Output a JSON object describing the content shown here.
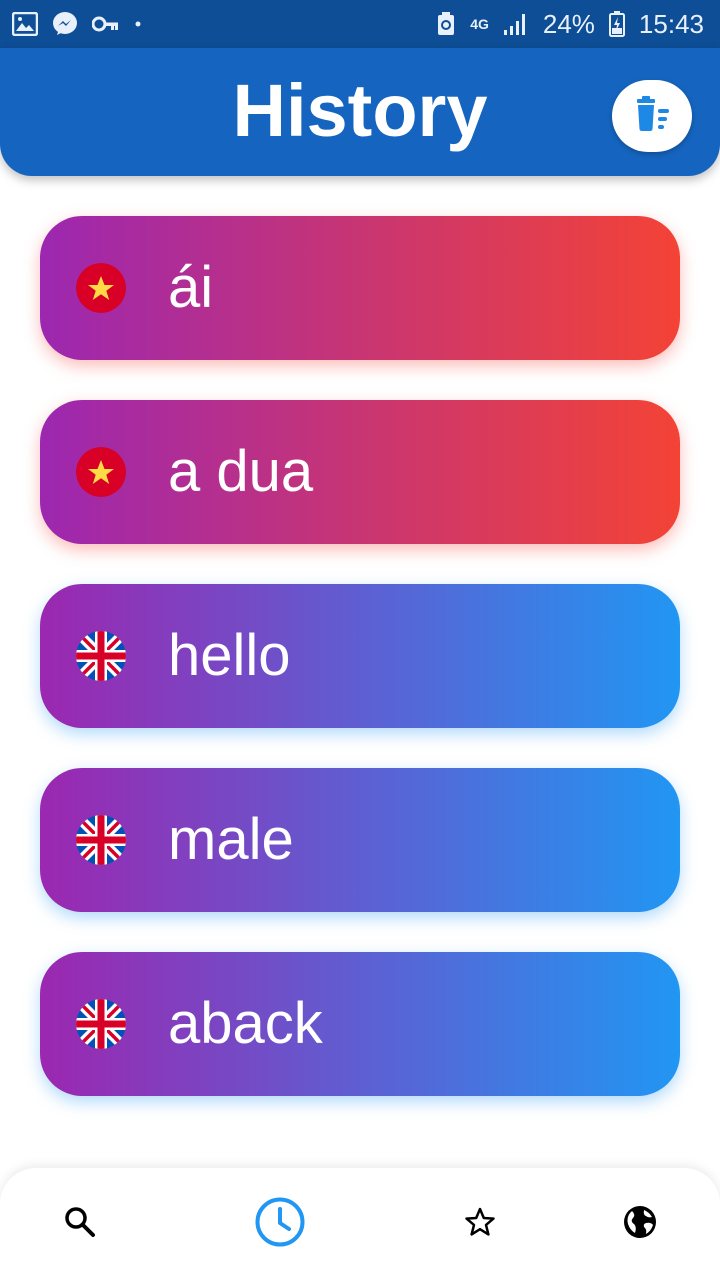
{
  "status_bar": {
    "battery": "24%",
    "time": "15:43",
    "network": "4G",
    "icons": [
      "gallery-icon",
      "messenger-icon",
      "key-icon",
      "dot-icon",
      "recycle-icon",
      "signal-icon",
      "battery-icon"
    ]
  },
  "header": {
    "title": "History",
    "action_icon": "delete-list-icon"
  },
  "history": {
    "items": [
      {
        "word": "ái",
        "language": "vi",
        "flag": "vietnam-flag-icon"
      },
      {
        "word": "a dua",
        "language": "vi",
        "flag": "vietnam-flag-icon"
      },
      {
        "word": "hello",
        "language": "en",
        "flag": "uk-flag-icon"
      },
      {
        "word": "male",
        "language": "en",
        "flag": "uk-flag-icon"
      },
      {
        "word": "aback",
        "language": "en",
        "flag": "uk-flag-icon"
      }
    ]
  },
  "bottom_nav": {
    "items": [
      "search-icon",
      "history-icon",
      "favorites-icon",
      "globe-icon"
    ],
    "active": "history-icon"
  },
  "colors": {
    "header_blue": "#1565c0",
    "status_bar_blue": "#0d4e96",
    "vi_gradient": [
      "#9c27b0",
      "#f44336"
    ],
    "en_gradient": [
      "#9c27b0",
      "#2196f3"
    ],
    "active_nav": "#2196f3"
  }
}
